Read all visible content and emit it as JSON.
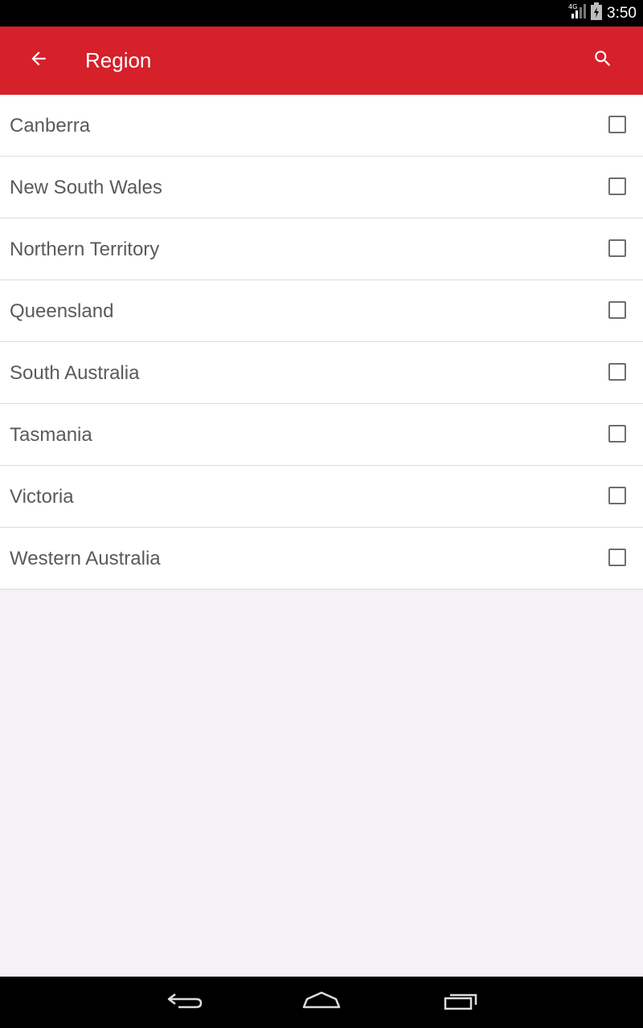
{
  "status": {
    "time": "3:50",
    "network": "4G"
  },
  "app_bar": {
    "title": "Region",
    "color": "#d6202a"
  },
  "regions": [
    {
      "label": "Canberra",
      "checked": false
    },
    {
      "label": "New South Wales",
      "checked": false
    },
    {
      "label": "Northern Territory",
      "checked": false
    },
    {
      "label": "Queensland",
      "checked": false
    },
    {
      "label": "South Australia",
      "checked": false
    },
    {
      "label": "Tasmania",
      "checked": false
    },
    {
      "label": "Victoria",
      "checked": false
    },
    {
      "label": "Western Australia",
      "checked": false
    }
  ],
  "icons": {
    "back": "arrow-left-icon",
    "search": "search-icon",
    "nav_back": "back-icon",
    "nav_home": "home-icon",
    "nav_recents": "recents-icon"
  }
}
